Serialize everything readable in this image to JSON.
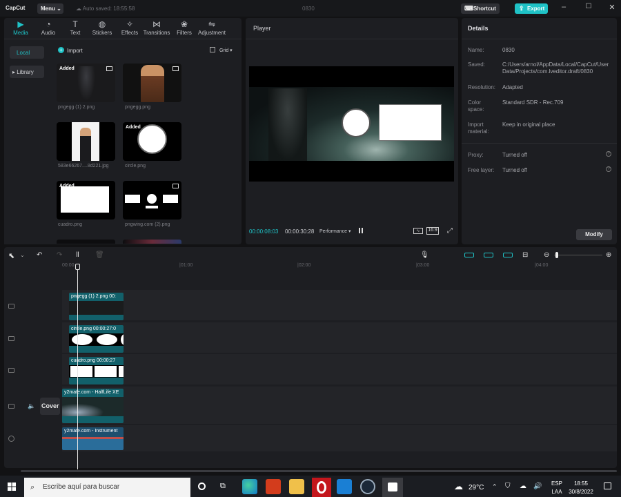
{
  "titlebar": {
    "app_name": "CapCut",
    "menu_label": "Menu",
    "autosave": "Auto saved: 18:55:58",
    "project_title": "0830",
    "shortcut_label": "Shortcut",
    "export_label": "Export"
  },
  "toolbar": {
    "tabs": [
      {
        "label": "Media",
        "icon": "media-icon",
        "active": true
      },
      {
        "label": "Audio",
        "icon": "audio-icon"
      },
      {
        "label": "Text",
        "icon": "text-icon"
      },
      {
        "label": "Stickers",
        "icon": "stickers-icon"
      },
      {
        "label": "Effects",
        "icon": "effects-icon"
      },
      {
        "label": "Transitions",
        "icon": "transitions-icon"
      },
      {
        "label": "Filters",
        "icon": "filters-icon"
      },
      {
        "label": "Adjustment",
        "icon": "adjustment-icon"
      }
    ]
  },
  "sidebar": {
    "items": [
      {
        "label": "Local"
      },
      {
        "label": "▸ Library"
      }
    ]
  },
  "media": {
    "import_label": "Import",
    "view_label": "Grid ▾",
    "added_label": "Added",
    "items": [
      {
        "name": "pngegg (1) 2.png"
      },
      {
        "name": "pngegg.png"
      },
      {
        "name": "583e66267....8d221.jpg"
      },
      {
        "name": "circle.png"
      },
      {
        "name": "cuadro.png"
      },
      {
        "name": "pngwing.com (2).png"
      }
    ]
  },
  "player": {
    "title": "Player",
    "current_time": "00:00:08:03",
    "total_time": "00:00:30:28",
    "performance": "Performance ▾",
    "ratio": "16:9"
  },
  "details": {
    "title": "Details",
    "rows": [
      {
        "label": "Name:",
        "value": "0830"
      },
      {
        "label": "Saved:",
        "value": "C:/Users/arnol/AppData/Local/CapCut/User Data/Projects/com.lveditor.draft/0830"
      },
      {
        "label": "Resolution:",
        "value": "Adapted"
      },
      {
        "label": "Color space:",
        "value": "Standard SDR - Rec.709"
      },
      {
        "label": "Import material:",
        "value": "Keep in original place"
      },
      {
        "label": "Proxy:",
        "value": "Turned off"
      },
      {
        "label": "Free layer:",
        "value": "Turned off"
      }
    ],
    "modify_label": "Modify"
  },
  "timeline": {
    "ruler": [
      "00:00",
      "|01:00",
      "|02:00",
      "|03:00",
      "|04:00"
    ],
    "cover_label": "Cover",
    "clips": [
      {
        "label": "pngegg (1) 2.png  00:"
      },
      {
        "label": "circle.png   00:00:27:0"
      },
      {
        "label": "cuadro.png   00:00:27"
      },
      {
        "label": "y2mate.com - HalfLife  XE"
      },
      {
        "label": "y2mate.com - Instrument"
      }
    ]
  },
  "taskbar": {
    "search_placeholder": "Escribe aquí para buscar",
    "weather": "29°C",
    "lang1": "ESP",
    "lang2": "LAA",
    "time": "18:55",
    "date": "30/8/2022"
  },
  "colors": {
    "accent": "#1fc2c6",
    "panel": "#1d1e22",
    "background": "#121214"
  }
}
